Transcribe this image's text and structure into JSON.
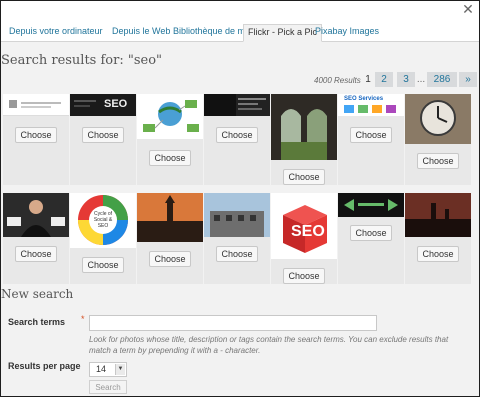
{
  "tabs": [
    {
      "label": "Depuis votre ordinateur"
    },
    {
      "label": "Depuis le Web"
    },
    {
      "label": "Bibliothèque de médias"
    },
    {
      "label": "Flickr - Pick a Pic"
    },
    {
      "label": "Pixabay Images"
    }
  ],
  "results": {
    "heading": "Search results for: \"seo\"",
    "count": "4000 Results",
    "pagination": {
      "current": "1",
      "pages": [
        "2",
        "3"
      ],
      "ellipsis": "...",
      "last": "286",
      "next": "»"
    },
    "choose_label": "Choose"
  },
  "thumbnails": {
    "row1": [
      {
        "icon": "seo-banner-thumbnail",
        "text": ""
      },
      {
        "icon": "seo-dark-thumbnail",
        "text": "SEO"
      },
      {
        "icon": "globe-network-thumbnail",
        "text": ""
      },
      {
        "icon": "book-cover-thumbnail",
        "text": ""
      },
      {
        "icon": "cloister-thumbnail",
        "text": ""
      },
      {
        "icon": "seo-services-thumbnail",
        "text": "SEO Services"
      },
      {
        "icon": "clock-tower-thumbnail",
        "text": ""
      }
    ],
    "row2": [
      {
        "icon": "businessman-thumbnail",
        "text": ""
      },
      {
        "icon": "social-seo-cycle-thumbnail",
        "text": "Cycle of Social & SEO"
      },
      {
        "icon": "sunset-tower-thumbnail",
        "text": ""
      },
      {
        "icon": "building-thumbnail",
        "text": ""
      },
      {
        "icon": "seo-cube-thumbnail",
        "text": "SEO"
      },
      {
        "icon": "arrows-dark-thumbnail",
        "text": ""
      },
      {
        "icon": "city-sunset-thumbnail",
        "text": ""
      }
    ]
  },
  "new_search": {
    "heading": "New search",
    "terms_label": "Search terms",
    "required_mark": "*",
    "terms_value": "",
    "help": "Look for photos whose title, description or tags contain the search terms. You can exclude results that match a term by prepending it with a - character.",
    "per_page_label": "Results per page",
    "per_page_value": "14",
    "search_button": "Search"
  },
  "colors": {
    "link": "#21759b",
    "panel": "#f2f2f2",
    "frame": "#1e1e1e"
  }
}
